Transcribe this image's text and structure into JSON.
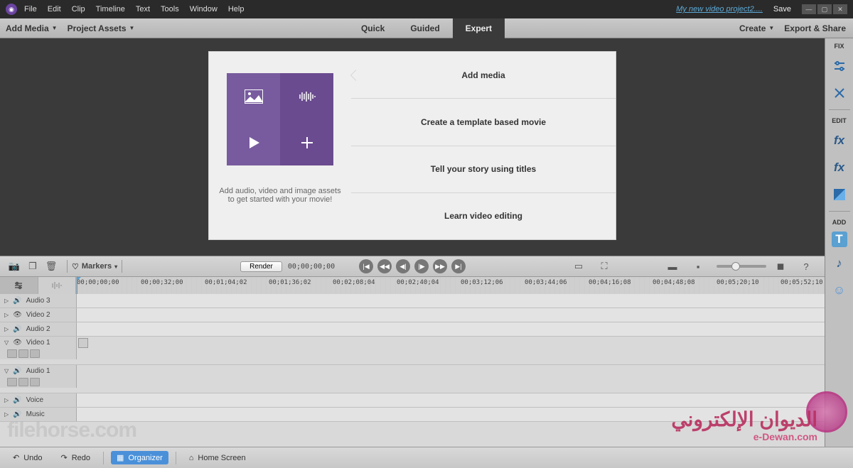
{
  "titlebar": {
    "menus": [
      "File",
      "Edit",
      "Clip",
      "Timeline",
      "Text",
      "Tools",
      "Window",
      "Help"
    ],
    "project_name": "My new video project2....",
    "save": "Save"
  },
  "toolbar": {
    "add_media": "Add Media",
    "project_assets": "Project Assets",
    "modes": {
      "quick": "Quick",
      "guided": "Guided",
      "expert": "Expert"
    },
    "active_mode": "expert",
    "create": "Create",
    "export": "Export & Share"
  },
  "welcome": {
    "hint": "Add audio, video and image assets to get started with your movie!",
    "items": [
      "Add media",
      "Create a template based movie",
      "Tell your story using titles",
      "Learn video editing"
    ]
  },
  "side": {
    "fix": "FIX",
    "edit": "EDIT",
    "add": "ADD"
  },
  "timeline_bar": {
    "markers": "Markers",
    "render": "Render",
    "timecode": "00;00;00;00"
  },
  "ruler": {
    "marks": [
      "00;00;00;00",
      "00;00;32;00",
      "00;01;04;02",
      "00;01;36;02",
      "00;02;08;04",
      "00;02;40;04",
      "00;03;12;06",
      "00;03;44;06",
      "00;04;16;08",
      "00;04;48;08",
      "00;05;20;10",
      "00;05;52;10"
    ]
  },
  "tracks": [
    {
      "name": "Audio 3",
      "type": "audio",
      "expand": "right"
    },
    {
      "name": "Video 2",
      "type": "video",
      "expand": "right"
    },
    {
      "name": "Audio 2",
      "type": "audio",
      "expand": "right"
    },
    {
      "name": "Video 1",
      "type": "video",
      "expand": "down",
      "tall": true
    },
    {
      "name": "Audio 1",
      "type": "audio",
      "expand": "down",
      "tall": true
    },
    {
      "name": "Voice",
      "type": "audio",
      "expand": "right"
    },
    {
      "name": "Music",
      "type": "audio",
      "expand": "right"
    }
  ],
  "bottombar": {
    "undo": "Undo",
    "redo": "Redo",
    "organizer": "Organizer",
    "home": "Home Screen"
  },
  "watermarks": {
    "left": "filehorse.com",
    "right_ar": "الديوان الإلكتروني",
    "right_en": "e-Dewan.com"
  }
}
